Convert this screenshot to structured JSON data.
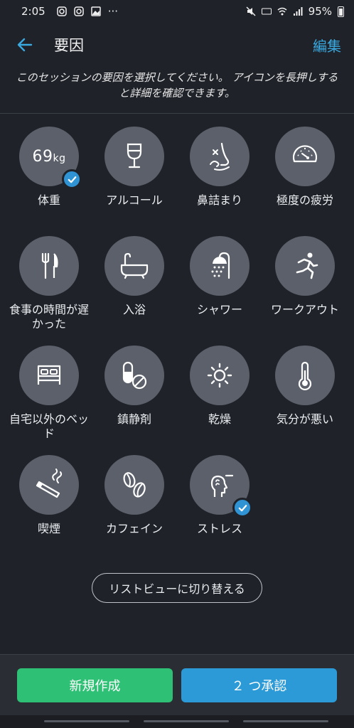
{
  "status_bar": {
    "time": "2:05",
    "battery": "95%",
    "more": "···"
  },
  "header": {
    "title": "要因",
    "edit_label": "編集"
  },
  "description": "このセッションの要因を選択してください。 アイコンを長押しすると詳細を確認できます。",
  "weight": {
    "value": "69",
    "unit": "kg"
  },
  "factors": [
    {
      "label": "体重",
      "icon": "weight-icon",
      "selected": true
    },
    {
      "label": "アルコール",
      "icon": "wine-glass-icon",
      "selected": false
    },
    {
      "label": "鼻詰まり",
      "icon": "nose-icon",
      "selected": false
    },
    {
      "label": "極度の疲労",
      "icon": "speedometer-icon",
      "selected": false
    },
    {
      "label": "食事の時間が遅かった",
      "icon": "fork-knife-icon",
      "selected": false
    },
    {
      "label": "入浴",
      "icon": "bathtub-icon",
      "selected": false
    },
    {
      "label": "シャワー",
      "icon": "shower-icon",
      "selected": false
    },
    {
      "label": "ワークアウト",
      "icon": "running-icon",
      "selected": false
    },
    {
      "label": "自宅以外のベッド",
      "icon": "bed-icon",
      "selected": false
    },
    {
      "label": "鎮静剤",
      "icon": "pills-icon",
      "selected": false
    },
    {
      "label": "乾燥",
      "icon": "sun-icon",
      "selected": false
    },
    {
      "label": "気分が悪い",
      "icon": "thermometer-icon",
      "selected": false
    },
    {
      "label": "喫煙",
      "icon": "cigarette-icon",
      "selected": false
    },
    {
      "label": "カフェイン",
      "icon": "coffee-bean-icon",
      "selected": false
    },
    {
      "label": "ストレス",
      "icon": "stress-head-icon",
      "selected": true
    }
  ],
  "list_view_label": "リストビューに切り替える",
  "footer": {
    "new_label": "新規作成",
    "confirm_label": "２ つ承認"
  },
  "colors": {
    "accent": "#39a9e0",
    "new_button": "#2ec074",
    "confirm_button": "#2b9ad6",
    "circle": "#5b606a"
  }
}
